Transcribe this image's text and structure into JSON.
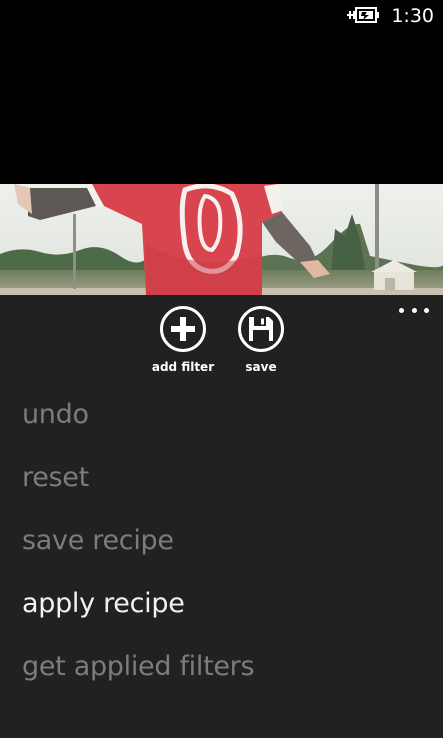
{
  "status_bar": {
    "time": "1:30",
    "battery_icon": "battery-charging-icon"
  },
  "photo": {
    "jersey_number": "0"
  },
  "app_bar": {
    "more_icon": "ellipsis-icon",
    "buttons": [
      {
        "label": "add filter",
        "icon": "plus-icon"
      },
      {
        "label": "save",
        "icon": "floppy-disk-icon"
      }
    ],
    "menu_items": [
      {
        "label": "undo"
      },
      {
        "label": "reset"
      },
      {
        "label": "save recipe"
      },
      {
        "label": "apply recipe"
      },
      {
        "label": "get applied filters"
      }
    ]
  },
  "colors": {
    "app_bar_bg": "#212121",
    "menu_text_disabled": "#7c7c7c",
    "menu_text_enabled": "#f2f2f2"
  }
}
